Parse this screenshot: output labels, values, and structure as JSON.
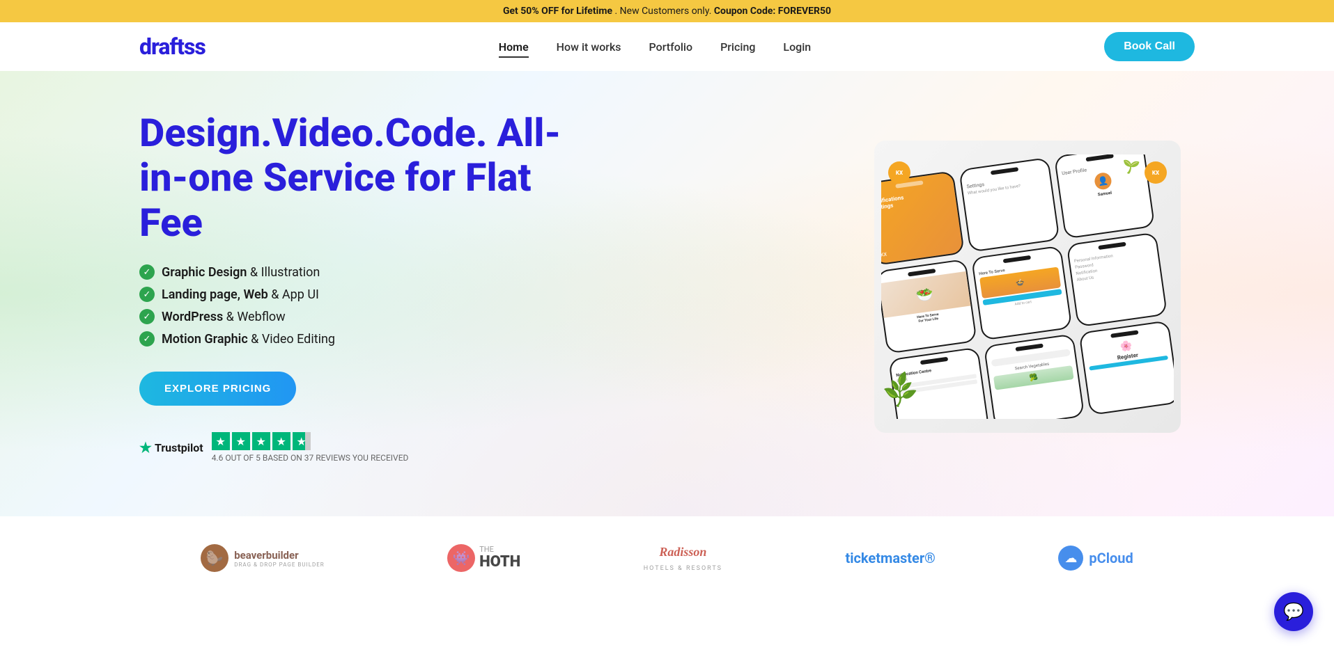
{
  "banner": {
    "text_prefix": "Get 50% OFF for Lifetime",
    "text_middle": ". New Customers only. ",
    "text_coupon": "Coupon Code: FOREVER50"
  },
  "nav": {
    "logo": "draftss",
    "links": [
      {
        "label": "Home",
        "active": true
      },
      {
        "label": "How it works",
        "active": false
      },
      {
        "label": "Portfolio",
        "active": false
      },
      {
        "label": "Pricing",
        "active": false
      },
      {
        "label": "Login",
        "active": false
      }
    ],
    "book_call": "Book Call"
  },
  "hero": {
    "title": "Design.Video.Code. All-in-one Service for Flat Fee",
    "features": [
      {
        "bold": "Graphic Design",
        "rest": " & Illustration"
      },
      {
        "bold": "Landing page, Web",
        "rest": " & App UI"
      },
      {
        "bold": "WordPress",
        "rest": " & Webflow"
      },
      {
        "bold": "Motion Graphic",
        "rest": " & Video Editing"
      }
    ],
    "cta_button": "EXPLORE PRICING",
    "trustpilot": {
      "label": "Trustpilot",
      "rating": "4.6 OUT OF 5 BASED ON 37 REVIEWS YOU RECEIVED"
    }
  },
  "logos": [
    {
      "name": "beaverbuilder",
      "display": "BeaverBuilder"
    },
    {
      "name": "thehoth",
      "display": "THE HOTH"
    },
    {
      "name": "radisson",
      "display": "Radisson"
    },
    {
      "name": "ticketmaster",
      "display": "ticketmaster®"
    },
    {
      "name": "pcloud",
      "display": "pCloud"
    }
  ],
  "colors": {
    "brand_blue": "#2a1fdb",
    "accent_cyan": "#1eb8e0",
    "check_green": "#2da44e",
    "trustpilot_green": "#00b67a",
    "banner_yellow": "#f5c842"
  }
}
